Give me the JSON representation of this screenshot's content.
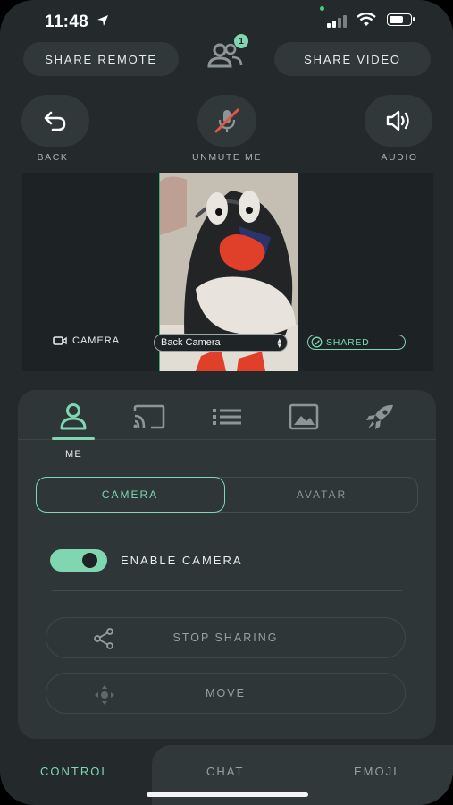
{
  "status_bar": {
    "time": "11:48"
  },
  "header": {
    "share_remote": "SHARE REMOTE",
    "share_video": "SHARE VIDEO",
    "participants_badge": "1",
    "participants_icon": "users-icon"
  },
  "controls": {
    "back": "BACK",
    "unmute": "UNMUTE ME",
    "audio": "AUDIO"
  },
  "video": {
    "camera_label": "CAMERA",
    "camera_select": "Back Camera",
    "shared_label": "SHARED"
  },
  "tabs": {
    "items": [
      "person-icon",
      "cast-icon",
      "list-icon",
      "image-icon",
      "rocket-icon"
    ],
    "active_label": "ME"
  },
  "segment": {
    "camera": "CAMERA",
    "avatar": "AVATAR"
  },
  "toggle": {
    "label": "ENABLE CAMERA",
    "enabled": true
  },
  "actions": {
    "stop_sharing": "STOP SHARING",
    "move": "MOVE"
  },
  "bottom_nav": {
    "control": "CONTROL",
    "chat": "CHAT",
    "emoji": "EMOJI"
  },
  "colors": {
    "accent": "#7fd6b0",
    "background": "#242a2c",
    "surface": "#30383a",
    "muted_red": "#e0554a"
  }
}
